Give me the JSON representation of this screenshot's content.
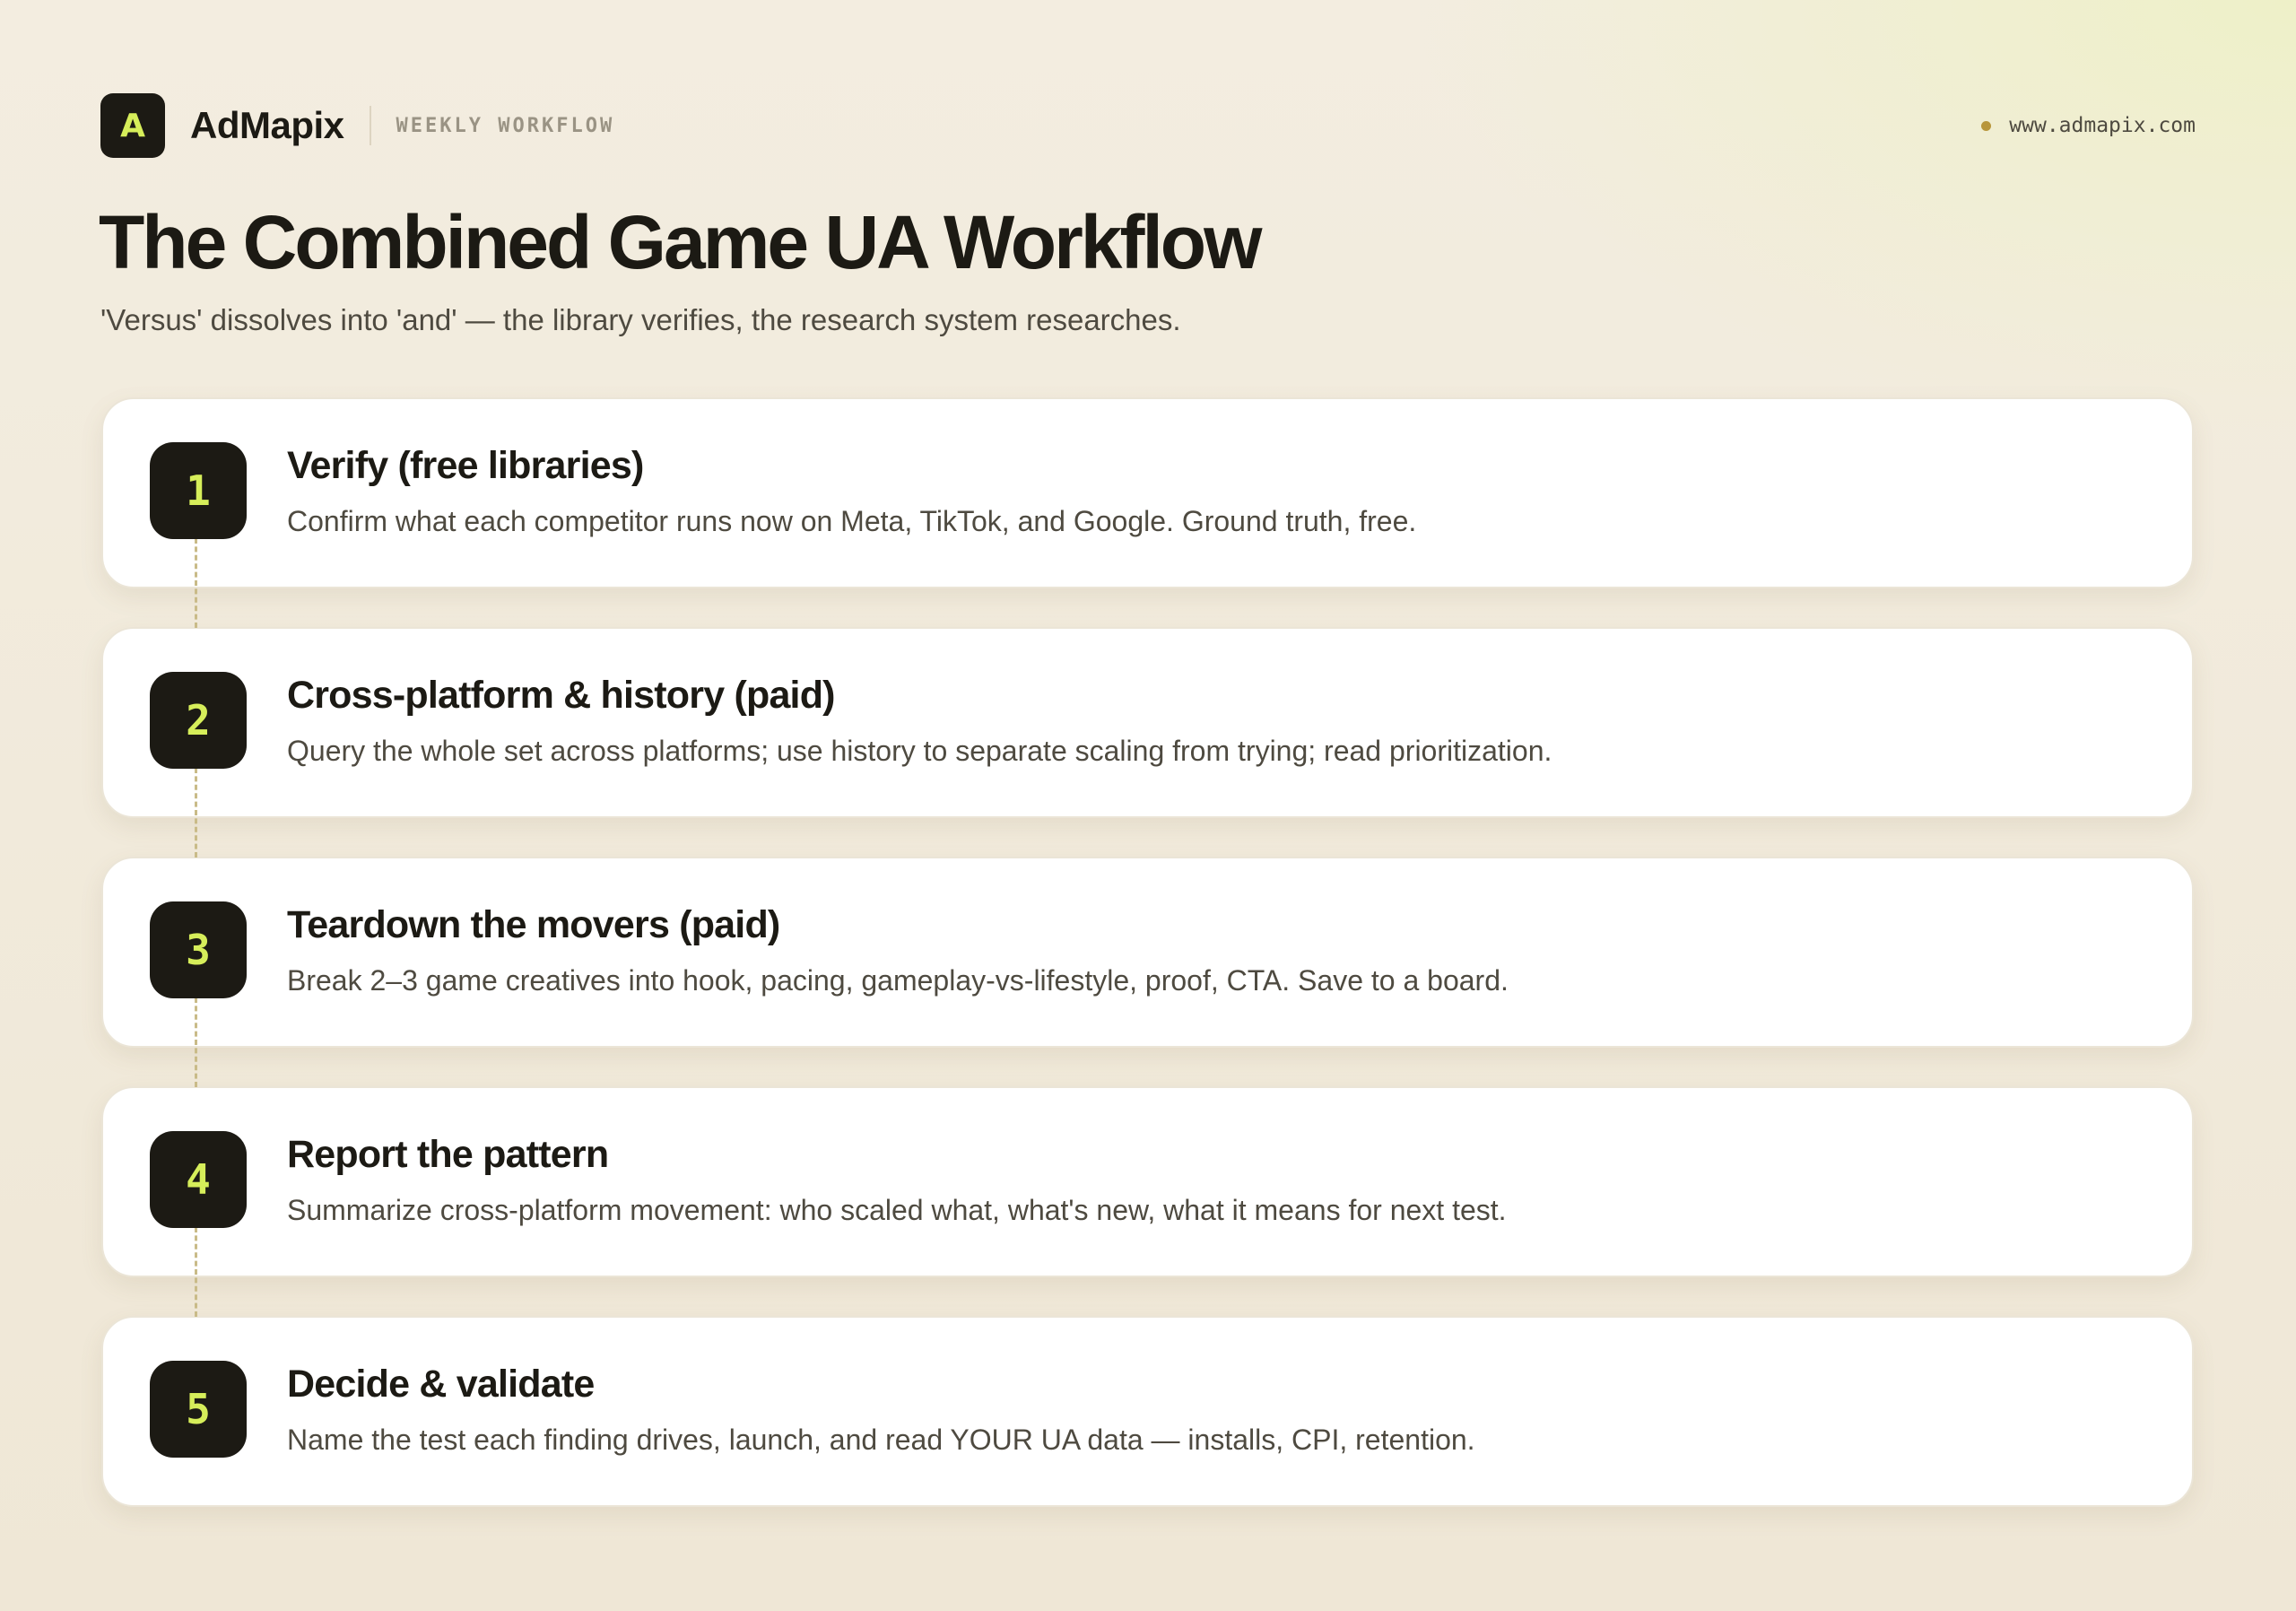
{
  "header": {
    "logo_letter": "A",
    "brand": "AdMapix",
    "tag": "WEEKLY WORKFLOW",
    "url": "www.admapix.com"
  },
  "title": "The Combined Game UA Workflow",
  "subtitle": "'Versus' dissolves into 'and' — the library verifies, the research system researches.",
  "steps": [
    {
      "number": "1",
      "title": "Verify (free libraries)",
      "description": "Confirm what each competitor runs now on Meta, TikTok, and Google. Ground truth, free."
    },
    {
      "number": "2",
      "title": "Cross-platform & history (paid)",
      "description": "Query the whole set across platforms; use history to separate scaling from trying; read prioritization."
    },
    {
      "number": "3",
      "title": "Teardown the movers (paid)",
      "description": "Break 2–3 game creatives into hook, pacing, gameplay-vs-lifestyle, proof, CTA. Save to a board."
    },
    {
      "number": "4",
      "title": "Report the pattern",
      "description": "Summarize cross-platform movement: who scaled what, what's new, what it means for next test."
    },
    {
      "number": "5",
      "title": "Decide & validate",
      "description": "Name the test each finding drives, launch, and read YOUR UA data — installs, CPI, retention."
    }
  ],
  "colors": {
    "accent": "#d6ee5a",
    "dark": "#1c1a14",
    "dot": "#b8963c"
  }
}
